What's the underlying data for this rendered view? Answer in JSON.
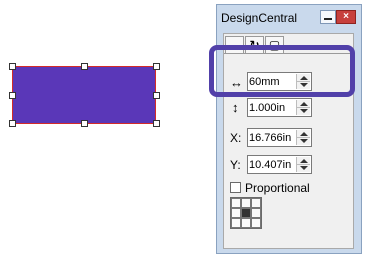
{
  "panel": {
    "title": "DesignCentral",
    "tabs": [
      {
        "icon": "move-arrows-icon",
        "label": "↔"
      },
      {
        "icon": "rotate-arrows-icon",
        "label": "↻"
      },
      {
        "icon": "square-icon",
        "label": "▢"
      }
    ],
    "fields": {
      "width": {
        "icon": "horizontal-arrow-icon",
        "glyph": "↔",
        "value": "60mm"
      },
      "height": {
        "icon": "vertical-arrow-icon",
        "glyph": "↕",
        "value": "1.000in"
      },
      "x": {
        "label": "X:",
        "value": "16.766in"
      },
      "y": {
        "label": "Y:",
        "value": "10.407in"
      }
    },
    "proportional": {
      "label": "Proportional",
      "checked": false
    },
    "anchor": {
      "selected_index": 4
    }
  },
  "shape": {
    "fill": "#5a37b8",
    "outline": "#d32a2a"
  },
  "highlight_color": "#5140a9"
}
